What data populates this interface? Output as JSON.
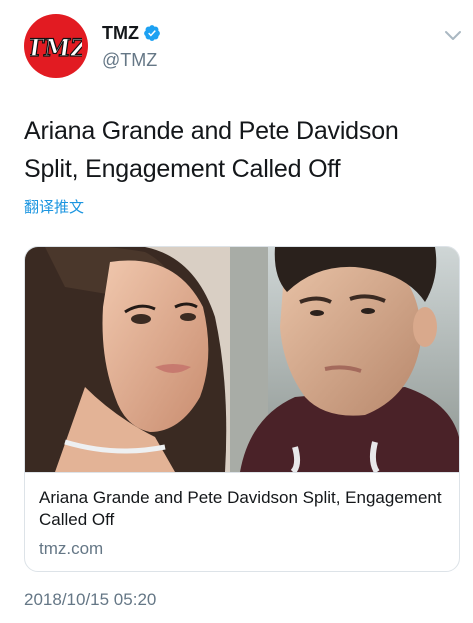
{
  "account": {
    "display_name": "TMZ",
    "handle": "@TMZ",
    "avatar_logo_text": "TMZ",
    "verified": true,
    "brand_color": "#e21b22"
  },
  "tweet": {
    "text": "Ariana Grande and Pete Davidson Split, Engagement Called Off",
    "translate_label": "翻译推文",
    "timestamp": "2018/10/15 05:20"
  },
  "card": {
    "title": "Ariana Grande and Pete Davidson Split, Engagement Called Off",
    "domain": "tmz.com"
  },
  "icons": {
    "verified": "verified-badge-icon",
    "menu": "chevron-down-icon"
  },
  "colors": {
    "link": "#1b95e0",
    "secondary_text": "#657786",
    "verified": "#1da1f2"
  }
}
